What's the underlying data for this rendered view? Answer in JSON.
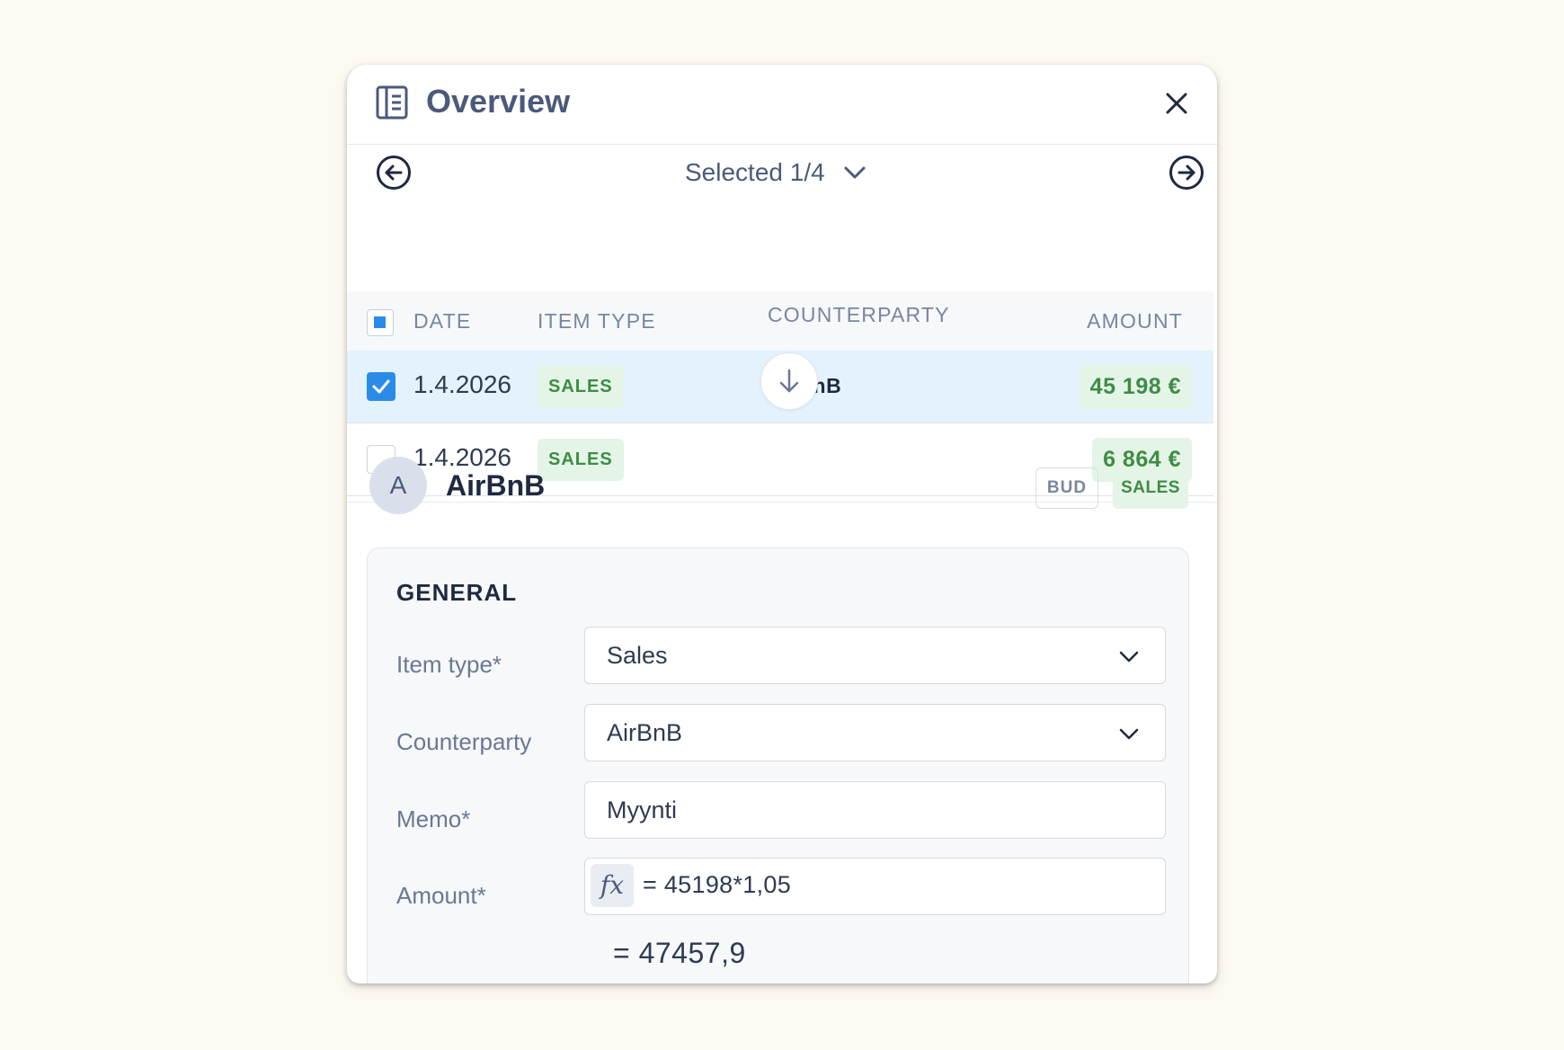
{
  "header": {
    "title": "Overview"
  },
  "nav": {
    "selected_label": "Selected 1/4"
  },
  "table": {
    "headers": {
      "date": "DATE",
      "item_type": "ITEM TYPE",
      "counterparty": "COUNTERPARTY",
      "amount": "AMOUNT"
    },
    "rows": [
      {
        "checked": true,
        "date": "1.4.2026",
        "item_type": "SALES",
        "counterparty": "AirBnB",
        "amount": "45 198 €"
      },
      {
        "checked": false,
        "date": "1.4.2026",
        "item_type": "SALES",
        "counterparty": "",
        "amount": "6 864 €"
      }
    ]
  },
  "detail": {
    "avatar_letter": "A",
    "name": "AirBnB",
    "tags": {
      "bud": "BUD",
      "sales": "SALES"
    }
  },
  "general": {
    "title": "GENERAL",
    "item_type_label": "Item type*",
    "item_type_value": "Sales",
    "counterparty_label": "Counterparty",
    "counterparty_value": "AirBnB",
    "memo_label": "Memo*",
    "memo_value": "Myynti",
    "amount_label": "Amount*",
    "amount_formula": "= 45198*1,05",
    "amount_result": "= 47457,9",
    "fx_symbol": "fx"
  },
  "colors": {
    "accent": "#2b8ce8",
    "selected_row": "#e3f2fc",
    "badge_green_bg": "#e4f4e6",
    "badge_green_text": "#3e8c46",
    "page_bg": "#fdfaf2"
  },
  "icons": {
    "header": "book-icon",
    "close": "close-icon",
    "prev": "arrow-left-circle-icon",
    "next": "arrow-right-circle-icon",
    "dropdown": "chevron-down-icon",
    "scroll": "arrow-down-icon",
    "checkbox": "checkmark-icon"
  }
}
